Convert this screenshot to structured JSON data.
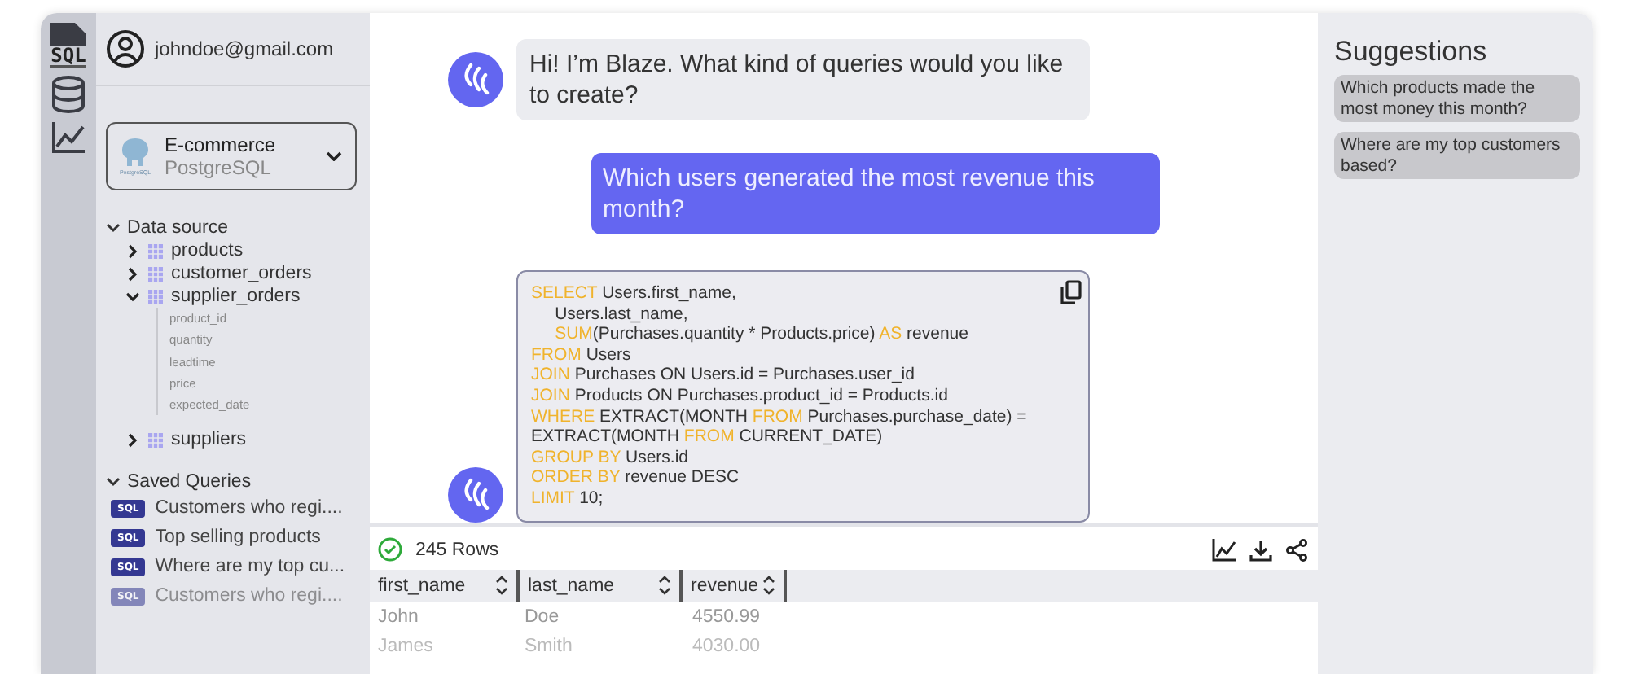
{
  "rail": [
    {
      "kind": "sql",
      "label": "SQL"
    },
    {
      "kind": "database"
    },
    {
      "kind": "chart"
    }
  ],
  "account": {
    "email": "johndoe@gmail.com"
  },
  "source_select": {
    "logo_text": "PostgreSQL",
    "name": "E-commerce",
    "engine": "PostgreSQL"
  },
  "data_source": {
    "label": "Data source",
    "expanded": true,
    "tables": [
      {
        "name": "products",
        "expanded": false
      },
      {
        "name": "customer_orders",
        "expanded": false
      },
      {
        "name": "supplier_orders",
        "expanded": true,
        "children": [
          "product_id",
          "quantity",
          "leadtime",
          "price",
          "expected_date"
        ]
      },
      {
        "name": "suppliers",
        "expanded": false
      }
    ]
  },
  "saved_queries": {
    "label": "Saved Queries",
    "expanded": true,
    "items": [
      {
        "badge": "SQL",
        "title": "Customers who regi...."
      },
      {
        "badge": "SQL",
        "title": "Top selling products"
      },
      {
        "badge": "SQL",
        "title": "Where are my top cu..."
      },
      {
        "badge": "SQL",
        "title": "Customers who regi...."
      }
    ]
  },
  "messages": [
    {
      "kind": "bot",
      "text": "Hi! I’m Blaze. What kind of queries would you like to create?"
    },
    {
      "kind": "user",
      "text": "Which users generated the most revenue this month?"
    },
    {
      "kind": "code",
      "lines": [
        {
          "parts": [
            {
              "kind": "keyword",
              "text": "SELECT"
            },
            {
              "kind": "plain",
              "text": " Users.first_name,"
            }
          ]
        },
        {
          "parts": [
            {
              "kind": "plain",
              "text": "     Users.last_name,"
            }
          ]
        },
        {
          "parts": [
            {
              "kind": "keyword",
              "text": "     SUM"
            },
            {
              "kind": "plain",
              "text": "(Purchases.quantity * Products.price) "
            },
            {
              "kind": "keyword",
              "text": "AS"
            },
            {
              "kind": "plain",
              "text": " revenue"
            }
          ]
        },
        {
          "parts": [
            {
              "kind": "keyword",
              "text": "FROM"
            },
            {
              "kind": "plain",
              "text": " Users"
            }
          ]
        },
        {
          "parts": [
            {
              "kind": "keyword",
              "text": "JOIN"
            },
            {
              "kind": "plain",
              "text": " Purchases ON Users.id = Purchases.user_id"
            }
          ]
        },
        {
          "parts": [
            {
              "kind": "keyword",
              "text": "JOIN"
            },
            {
              "kind": "plain",
              "text": " Products ON Purchases.product_id = Products.id"
            }
          ]
        },
        {
          "parts": [
            {
              "kind": "keyword",
              "text": "WHERE"
            },
            {
              "kind": "plain",
              "text": " EXTRACT(MONTH "
            },
            {
              "kind": "keyword",
              "text": "FROM"
            },
            {
              "kind": "plain",
              "text": " Purchases.purchase_date) ="
            }
          ]
        },
        {
          "parts": [
            {
              "kind": "plain",
              "text": "EXTRACT(MONTH "
            },
            {
              "kind": "keyword",
              "text": "FROM"
            },
            {
              "kind": "plain",
              "text": " CURRENT_DATE)"
            }
          ]
        },
        {
          "parts": [
            {
              "kind": "keyword",
              "text": "GROUP BY"
            },
            {
              "kind": "plain",
              "text": " Users.id"
            }
          ]
        },
        {
          "parts": [
            {
              "kind": "keyword",
              "text": "ORDER BY"
            },
            {
              "kind": "plain",
              "text": " revenue DESC"
            }
          ]
        },
        {
          "parts": [
            {
              "kind": "keyword",
              "text": "LIMIT"
            },
            {
              "kind": "plain",
              "text": " 10;"
            }
          ]
        }
      ]
    }
  ],
  "results": {
    "status": "245 Rows",
    "columns": [
      "first_name",
      "last_name",
      "revenue"
    ],
    "rows": [
      [
        "John",
        "Doe",
        "4550.99"
      ],
      [
        "James",
        "Smith",
        "4030.00"
      ]
    ]
  },
  "suggestions": {
    "title": "Suggestions",
    "items": [
      "Which products made the most money this month?",
      "Where are my top customers based?"
    ]
  }
}
